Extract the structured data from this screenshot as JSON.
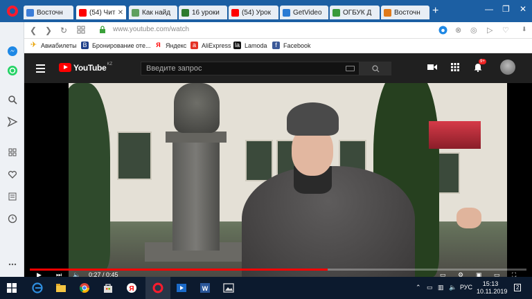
{
  "browser": {
    "tabs": [
      {
        "label": "Восточн",
        "favicon_color": "#3b7dd8",
        "active": false
      },
      {
        "label": "(54) Чит",
        "favicon_color": "#ff0000",
        "active": true
      },
      {
        "label": "Как найд",
        "favicon_color": "#5fa05f",
        "active": false
      },
      {
        "label": "16 уроки",
        "favicon_color": "#2d7b2d",
        "active": false
      },
      {
        "label": "(54) Урок",
        "favicon_color": "#ff0000",
        "active": false
      },
      {
        "label": "GetVideo",
        "favicon_color": "#2a7bd4",
        "active": false
      },
      {
        "label": "ОГБУК Д",
        "favicon_color": "#3a9a3a",
        "active": false
      },
      {
        "label": "Восточн",
        "favicon_color": "#e07a1a",
        "active": false
      }
    ],
    "url": {
      "host": "www.youtube.com",
      "path": "/watch"
    },
    "bookmarks": [
      {
        "label": "Авиабилеты",
        "icon": "plane-icon",
        "color": "#e8a100"
      },
      {
        "label": "Бронирование оте...",
        "icon": "booking-icon",
        "color": "#1e3f8a"
      },
      {
        "label": "Яндекс",
        "icon": "yandex-icon",
        "color": "#ff0000"
      },
      {
        "label": "AliExpress",
        "icon": "aliexpress-icon",
        "color": "#e43225"
      },
      {
        "label": "Lamoda",
        "icon": "lamoda-icon",
        "color": "#111111"
      },
      {
        "label": "Facebook",
        "icon": "facebook-icon",
        "color": "#3b5998"
      }
    ]
  },
  "youtube": {
    "logo": "YouTube",
    "region": "KZ",
    "search_placeholder": "Введите запрос",
    "notification_count": "9+",
    "player": {
      "current_time": "0:27",
      "duration": "0:45",
      "time_sep": " / ",
      "progress": 0.6
    }
  },
  "taskbar": {
    "language": "РУС",
    "time": "15:13",
    "date": "10.11.2019",
    "notification_count": "2"
  },
  "colors": {
    "accent_red": "#ff0000",
    "taskbar_bg": "#0c1a2e",
    "yt_header_bg": "#202020"
  }
}
